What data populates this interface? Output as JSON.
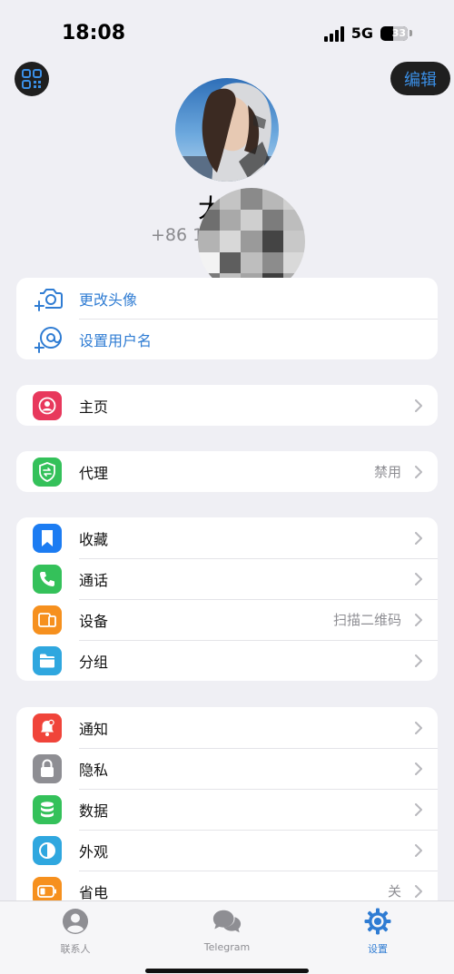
{
  "status_bar": {
    "time": "18:08",
    "network": "5G",
    "battery": "33"
  },
  "header": {
    "edit_label": "编辑",
    "name": "大",
    "phone": "+86 18"
  },
  "profile_actions": [
    {
      "label": "更改头像",
      "icon": "camera-add-icon"
    },
    {
      "label": "设置用户名",
      "icon": "at-sign-icon"
    }
  ],
  "groups": [
    [
      {
        "label": "主页",
        "value": "",
        "icon": "profile-page-icon",
        "color": "#E8385C"
      }
    ],
    [
      {
        "label": "代理",
        "value": "禁用",
        "icon": "proxy-shield-icon",
        "color": "#34C15A"
      }
    ],
    [
      {
        "label": "收藏",
        "value": "",
        "icon": "bookmark-icon",
        "color": "#1C7CF2"
      },
      {
        "label": "通话",
        "value": "",
        "icon": "phone-icon",
        "color": "#34C15A"
      },
      {
        "label": "设备",
        "value": "扫描二维码",
        "icon": "devices-icon",
        "color": "#F6901E"
      },
      {
        "label": "分组",
        "value": "",
        "icon": "folder-icon",
        "color": "#2FA7DF"
      }
    ],
    [
      {
        "label": "通知",
        "value": "",
        "icon": "bell-icon",
        "color": "#F0443A"
      },
      {
        "label": "隐私",
        "value": "",
        "icon": "lock-icon",
        "color": "#8E8E93"
      },
      {
        "label": "数据",
        "value": "",
        "icon": "database-icon",
        "color": "#34C15A"
      },
      {
        "label": "外观",
        "value": "",
        "icon": "appearance-icon",
        "color": "#2FA7DF"
      },
      {
        "label": "省电",
        "value": "关",
        "icon": "battery-icon",
        "color": "#F6901E"
      }
    ]
  ],
  "tab_bar": {
    "tabs": [
      {
        "label": "联系人",
        "icon": "contacts-icon",
        "active": false
      },
      {
        "label": "Telegram",
        "icon": "chats-icon",
        "active": false
      },
      {
        "label": "设置",
        "icon": "settings-gear-icon",
        "active": true
      }
    ]
  }
}
